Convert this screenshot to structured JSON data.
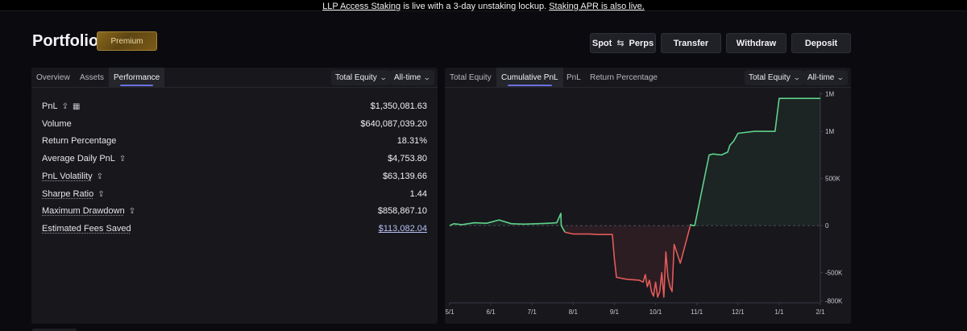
{
  "banner": {
    "link1": "LLP Access Staking",
    "middle": " is live with a 3-day unstaking lockup. ",
    "link2": "Staking APR is also live."
  },
  "header": {
    "title": "Portfolio",
    "badge": "Premium"
  },
  "actions": {
    "spot": "Spot",
    "perps": "Perps",
    "transfer": "Transfer",
    "withdraw": "Withdraw",
    "deposit": "Deposit"
  },
  "left_panel": {
    "tabs": [
      "Overview",
      "Assets",
      "Performance"
    ],
    "active_tab": "Performance",
    "dropdown_metric": "Total Equity",
    "dropdown_range": "All-time",
    "metrics": [
      {
        "label": "PnL",
        "value": "$1,350,081.63"
      },
      {
        "label": "Volume",
        "value": "$640,087,039.20"
      },
      {
        "label": "Return Percentage",
        "value": "18.31%"
      },
      {
        "label": "Average Daily PnL",
        "value": "$4,753.80"
      },
      {
        "label": "PnL Volatility",
        "value": "$63,139.66"
      },
      {
        "label": "Sharpe Ratio",
        "value": "1.44"
      },
      {
        "label": "Maximum Drawdown",
        "value": "$858,867.10"
      },
      {
        "label": "Estimated Fees Saved",
        "value": "$113,082.04"
      }
    ]
  },
  "right_panel": {
    "tabs": [
      "Total Equity",
      "Cumulative PnL",
      "PnL",
      "Return Percentage"
    ],
    "active_tab": "Cumulative PnL",
    "dropdown_metric": "Total Equity",
    "dropdown_range": "All-time"
  },
  "colors": {
    "positive": "#5fd38a",
    "negative": "#e35a5a",
    "accent": "#6a72e0"
  },
  "icons": {
    "share": "share-icon",
    "calendar": "calendar-icon",
    "swap": "swap-arrows-icon",
    "chevron": "chevron-down-icon"
  },
  "chart_data": {
    "type": "line",
    "title": "",
    "xlabel": "",
    "ylabel": "",
    "x_ticks": [
      "5/1",
      "6/1",
      "7/1",
      "8/1",
      "9/1",
      "10/1",
      "11/1",
      "12/1",
      "1/1",
      "2/1"
    ],
    "y_ticks": [
      {
        "value": 1400000,
        "label": "1M"
      },
      {
        "value": 1000000,
        "label": "1M"
      },
      {
        "value": 500000,
        "label": "500K"
      },
      {
        "value": 0,
        "label": "0"
      },
      {
        "value": -500000,
        "label": "-500K"
      },
      {
        "value": -800000,
        "label": "-800K"
      }
    ],
    "ylim": [
      -820000,
      1420000
    ],
    "x_month_index": [
      0,
      0.1,
      0.3,
      0.6,
      0.9,
      1.2,
      1.5,
      1.8,
      2.1,
      2.4,
      2.6,
      2.7,
      2.71,
      2.8,
      3.0,
      3.4,
      3.6,
      3.95,
      4.0,
      4.05,
      4.3,
      4.6,
      4.7,
      4.75,
      4.8,
      4.85,
      4.9,
      4.95,
      5.0,
      5.05,
      5.1,
      5.15,
      5.2,
      5.25,
      5.3,
      5.35,
      5.4,
      5.45,
      5.6,
      5.85,
      5.9,
      5.95,
      6.3,
      6.4,
      6.6,
      6.75,
      6.8,
      6.9,
      7.0,
      7.4,
      7.9,
      8.0,
      8.5,
      9.0
    ],
    "y_values": [
      0,
      20000,
      10000,
      30000,
      25000,
      60000,
      20000,
      15000,
      20000,
      25000,
      30000,
      130000,
      0,
      -70000,
      -90000,
      -90000,
      -95000,
      -95000,
      -350000,
      -550000,
      -570000,
      -580000,
      -600000,
      -520000,
      -650000,
      -580000,
      -700000,
      -750000,
      -600000,
      -760000,
      -700000,
      -500000,
      -760000,
      -280000,
      -550000,
      -650000,
      -700000,
      -200000,
      -400000,
      10000,
      0,
      0,
      750000,
      760000,
      750000,
      780000,
      850000,
      900000,
      980000,
      1000000,
      1000000,
      1350000,
      1350000,
      1350000
    ],
    "series": [
      {
        "name": "",
        "segments": "colored green above 0, red below 0"
      }
    ]
  }
}
